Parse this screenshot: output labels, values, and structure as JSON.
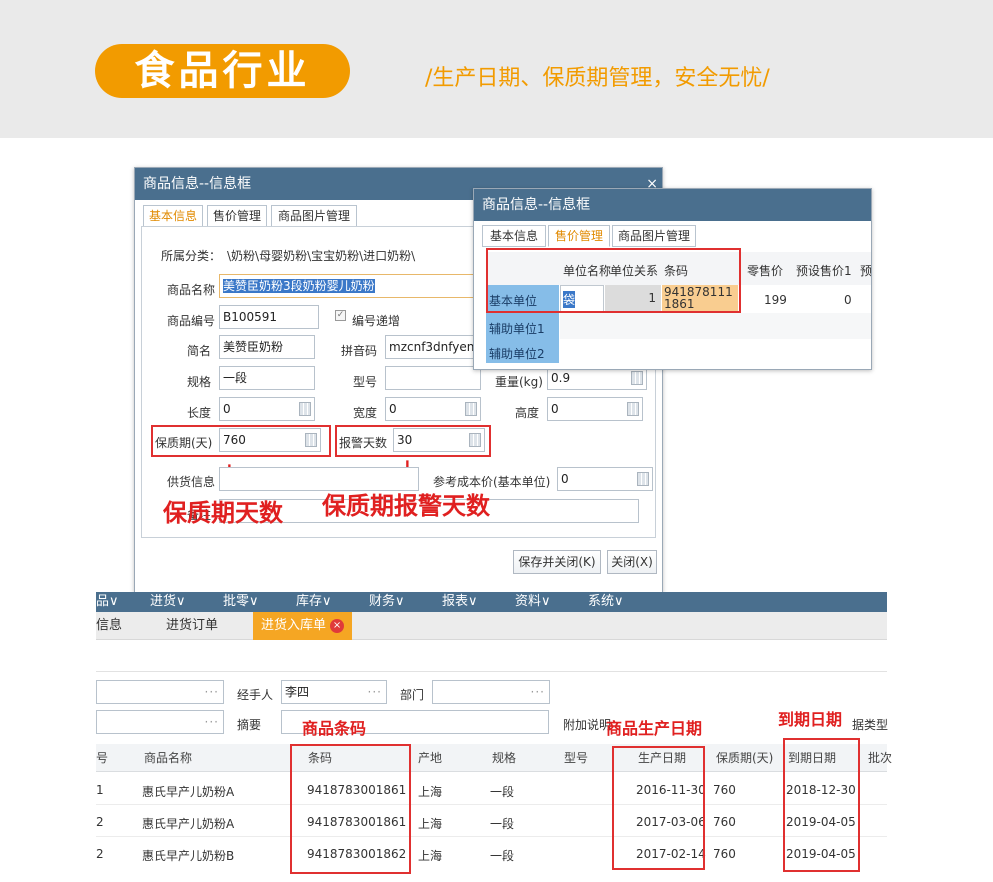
{
  "banner": {
    "badge": "食品行业",
    "tagline": "/生产日期、保质期管理，安全无忧/"
  },
  "dialog1": {
    "title": "商品信息--信息框",
    "close": "×",
    "tabs": [
      "基本信息",
      "售价管理",
      "商品图片管理"
    ],
    "category_label": "所属分类：",
    "category_value": "\\奶粉\\母婴奶粉\\宝宝奶粉\\进口奶粉\\",
    "name_label": "商品名称",
    "name_value": "美赞臣奶粉3段奶粉婴儿奶粉",
    "code_label": "商品编号",
    "code_value": "B100591",
    "auto_inc_label": "编号递增",
    "short_label": "简名",
    "short_value": "美赞臣奶粉",
    "pinyin_label": "拼音码",
    "pinyin_value": "mzcnf3dnfyenf",
    "spec_label": "规格",
    "spec_value": "一段",
    "model_label": "型号",
    "model_value": "",
    "weight_label": "重量(kg)",
    "weight_value": "0.9",
    "length_label": "长度",
    "length_value": "0",
    "width_label": "宽度",
    "width_value": "0",
    "height_label": "高度",
    "height_value": "0",
    "shelf_label": "保质期(天)",
    "shelf_value": "760",
    "alarm_label": "报警天数",
    "alarm_value": "30",
    "supply_label": "供货信息",
    "supply_value": "",
    "ref_cost_label": "参考成本价(基本单位)",
    "ref_cost_value": "0",
    "remark_label": "备注",
    "remark_value": "",
    "save_close": "保存并关闭(K)",
    "close_btn": "关闭(X)"
  },
  "annotations": {
    "shelf_days": "保质期天数",
    "alarm_days": "保质期报警天数",
    "barcode": "商品条码",
    "prod_date": "商品生产日期",
    "expiry": "到期日期"
  },
  "dialog2": {
    "title": "商品信息--信息框",
    "tabs": [
      "基本信息",
      "售价管理",
      "商品图片管理"
    ],
    "headers": [
      "单位名称",
      "单位关系",
      "条码",
      "零售价",
      "预设售价1",
      "预"
    ],
    "rows": [
      {
        "label": "基本单位",
        "unit": "袋",
        "relation": "1",
        "barcode": "9418781111861",
        "retail": "199",
        "preset": "0"
      },
      {
        "label": "辅助单位1"
      },
      {
        "label": "辅助单位2"
      }
    ]
  },
  "app": {
    "menu": [
      "品∨",
      "进货∨",
      "批零∨",
      "库存∨",
      "财务∨",
      "报表∨",
      "资料∨",
      "系统∨"
    ],
    "tabs": [
      "信息",
      "进货订单",
      "进货入库单"
    ],
    "tab_close": "×",
    "handler_label": "经手人",
    "handler_value": "李四",
    "dept_label": "部门",
    "summary_label": "摘要",
    "attach_label": "附加说明",
    "doc_type_label": "据类型",
    "dots": "···",
    "columns": [
      "号",
      "商品名称",
      "条码",
      "产地",
      "规格",
      "型号",
      "生产日期",
      "保质期(天)",
      "到期日期",
      "批次"
    ],
    "rows": [
      {
        "no": "1",
        "name": "惠氏早产儿奶粉A",
        "barcode": "9418783001861",
        "origin": "上海",
        "spec": "一段",
        "prod": "2016-11-30",
        "shelf": "760",
        "expiry": "2018-12-30"
      },
      {
        "no": "2",
        "name": "惠氏早产儿奶粉A",
        "barcode": "9418783001861",
        "origin": "上海",
        "spec": "一段",
        "prod": "2017-03-06",
        "shelf": "760",
        "expiry": "2019-04-05"
      },
      {
        "no": "2",
        "name": "惠氏早产儿奶粉B",
        "barcode": "9418783001862",
        "origin": "上海",
        "spec": "一段",
        "prod": "2017-02-14",
        "shelf": "760",
        "expiry": "2019-04-05"
      }
    ]
  }
}
